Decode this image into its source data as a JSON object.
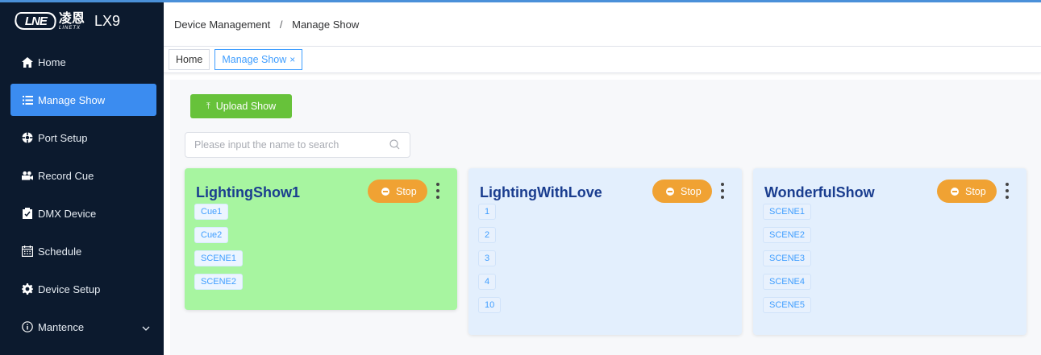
{
  "app": {
    "logo_text": "LNE",
    "logo_cn": "凌恩",
    "logo_en": "LINETX",
    "name": "LX9"
  },
  "sidebar": {
    "items": [
      {
        "label": "Home",
        "icon": "home-icon"
      },
      {
        "label": "Manage Show",
        "icon": "list-icon",
        "active": true
      },
      {
        "label": "Port Setup",
        "icon": "port-icon"
      },
      {
        "label": "Record Cue",
        "icon": "record-icon"
      },
      {
        "label": "DMX Device",
        "icon": "device-icon"
      },
      {
        "label": "Schedule",
        "icon": "calendar-icon"
      },
      {
        "label": "Device Setup",
        "icon": "gear-icon"
      },
      {
        "label": "Mantence",
        "icon": "info-icon",
        "expandable": true
      }
    ]
  },
  "header": {
    "breadcrumb": [
      "Device Management",
      "Manage Show"
    ],
    "separator": "/"
  },
  "tabs": [
    {
      "label": "Home"
    },
    {
      "label": "Manage Show",
      "active": true,
      "closable": "×"
    }
  ],
  "toolbar": {
    "upload_label": "Upload Show",
    "upload_icon": "⤒"
  },
  "search": {
    "placeholder": "Please input the name to search",
    "value": ""
  },
  "shows": [
    {
      "name": "LightingShow1",
      "stop_label": "Stop",
      "color": "#a7f5a0",
      "cues": [
        "Cue1",
        "Cue2",
        "SCENE1",
        "SCENE2"
      ]
    },
    {
      "name": "LightingWithLove",
      "stop_label": "Stop",
      "color": "#e3effd",
      "cues": [
        "1",
        "2",
        "3",
        "4",
        "10"
      ]
    },
    {
      "name": "WonderfulShow",
      "stop_label": "Stop",
      "color": "#e3effd",
      "cues": [
        "SCENE1",
        "SCENE2",
        "SCENE3",
        "SCENE4",
        "SCENE5"
      ]
    }
  ],
  "colors": {
    "sidebar_bg": "#0c1a2e",
    "accent": "#3b8cf0",
    "upload": "#67c23a",
    "stop": "#f0a233"
  }
}
